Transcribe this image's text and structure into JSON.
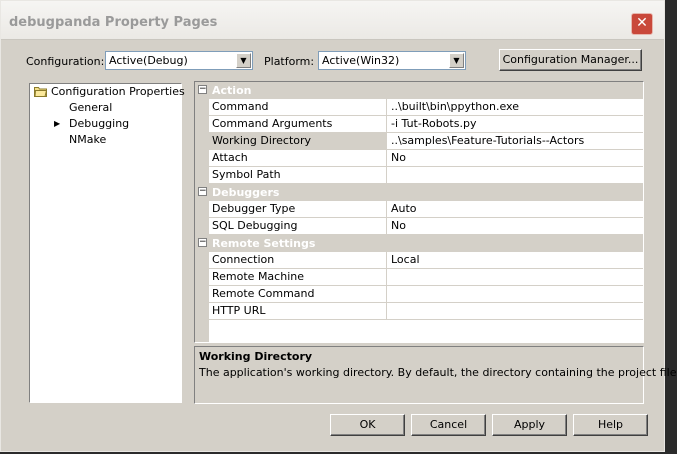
{
  "window": {
    "title": "debugpanda Property Pages",
    "close_glyph": "✕"
  },
  "toolbar": {
    "configuration_label": "Configuration:",
    "configuration_value": "Active(Debug)",
    "platform_label": "Platform:",
    "platform_value": "Active(Win32)",
    "config_manager_label": "Configuration Manager...",
    "dropdown_glyph": "▼"
  },
  "tree": {
    "root": "Configuration Properties",
    "items": [
      {
        "label": "General"
      },
      {
        "label": "Debugging",
        "selected": true
      },
      {
        "label": "NMake"
      }
    ],
    "selected_glyph": "▶"
  },
  "grid": {
    "collapse_glyph": "−",
    "categories": [
      {
        "name": "Action",
        "rows": [
          {
            "name": "Command",
            "value": "..\\built\\bin\\ppython.exe"
          },
          {
            "name": "Command Arguments",
            "value": "-i Tut-Robots.py"
          },
          {
            "name": "Working Directory",
            "value": "..\\samples\\Feature-Tutorials--Actors"
          },
          {
            "name": "Attach",
            "value": "No"
          },
          {
            "name": "Symbol Path",
            "value": ""
          }
        ]
      },
      {
        "name": "Debuggers",
        "rows": [
          {
            "name": "Debugger Type",
            "value": "Auto"
          },
          {
            "name": "SQL Debugging",
            "value": "No"
          }
        ]
      },
      {
        "name": "Remote Settings",
        "rows": [
          {
            "name": "Connection",
            "value": "Local"
          },
          {
            "name": "Remote Machine",
            "value": ""
          },
          {
            "name": "Remote Command",
            "value": ""
          },
          {
            "name": "HTTP URL",
            "value": ""
          }
        ]
      }
    ]
  },
  "description": {
    "title": "Working Directory",
    "text": "The application's working directory.  By default, the directory containing the project file."
  },
  "buttons": {
    "ok": "OK",
    "cancel": "Cancel",
    "apply": "Apply",
    "help": "Help"
  }
}
